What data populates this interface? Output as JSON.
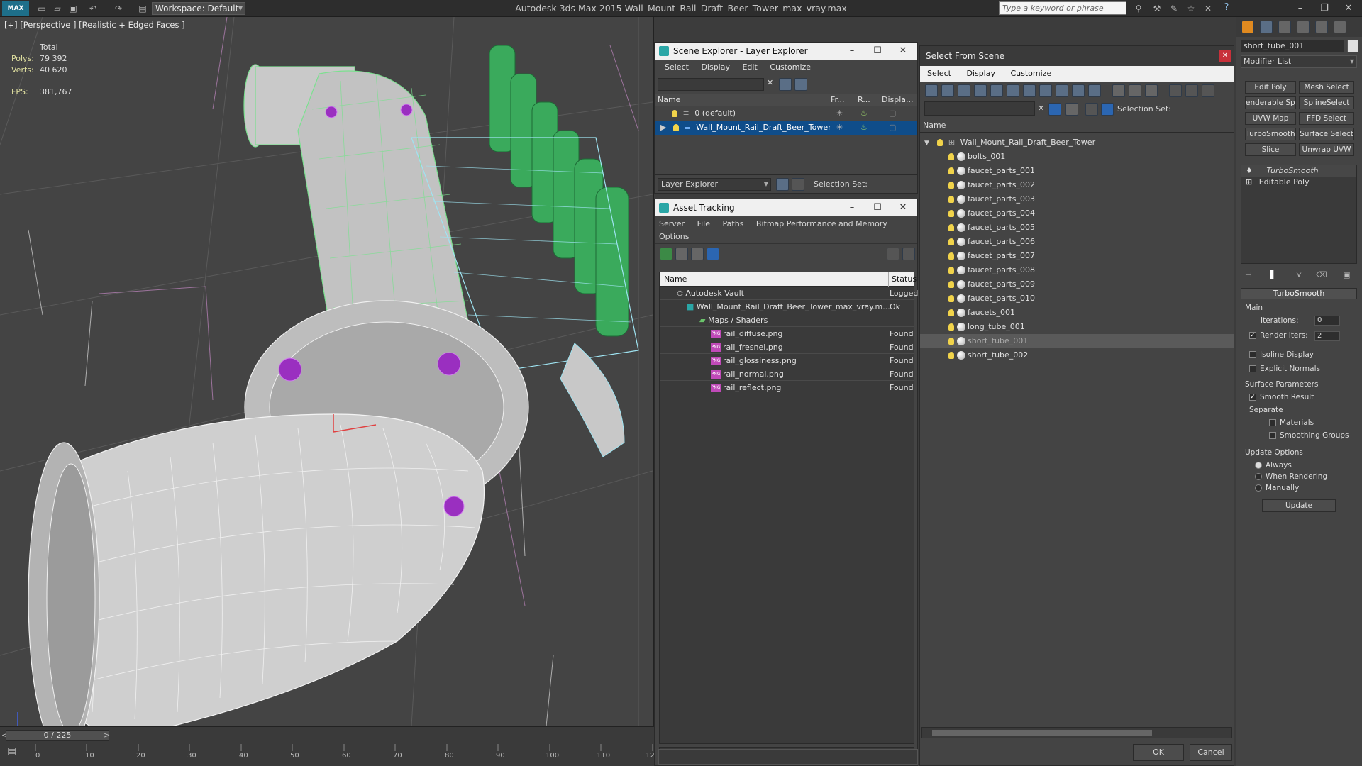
{
  "app": {
    "logo": "MAX",
    "workspace_label": "Workspace: Default",
    "title": "Autodesk 3ds Max  2015     Wall_Mount_Rail_Draft_Beer_Tower_max_vray.max",
    "search_placeholder": "Type a keyword or phrase"
  },
  "viewport": {
    "label": "[+] [Perspective ] [Realistic + Edged Faces ]",
    "stats": {
      "total_label": "Total",
      "polys_label": "Polys:",
      "polys_value": "79 392",
      "verts_label": "Verts:",
      "verts_value": "40 620",
      "fps_label": "FPS:",
      "fps_value": "381,767"
    }
  },
  "timeline": {
    "slider": "0 / 225",
    "prev": "<",
    "next": ">",
    "ticks": [
      "0",
      "10",
      "20",
      "30",
      "40",
      "50",
      "60",
      "70",
      "80",
      "90",
      "100",
      "110",
      "12"
    ]
  },
  "scene_explorer": {
    "title": "Scene Explorer - Layer Explorer",
    "menu": [
      "Select",
      "Display",
      "Edit",
      "Customize"
    ],
    "columns": {
      "name": "Name",
      "frozen": "Fr...",
      "render": "R...",
      "display": "Displa..."
    },
    "rows": [
      {
        "label": "0 (default)",
        "selected": false
      },
      {
        "label": "Wall_Mount_Rail_Draft_Beer_Tower",
        "selected": true
      }
    ],
    "footer_dropdown": "Layer Explorer",
    "footer_selection": "Selection Set:"
  },
  "asset_tracking": {
    "title": "Asset Tracking",
    "menu": [
      "Server",
      "File",
      "Paths",
      "Bitmap Performance and Memory"
    ],
    "menu2": "Options",
    "columns": {
      "name": "Name",
      "status": "Status"
    },
    "rows": [
      {
        "name": "Autodesk Vault",
        "status": "Logged",
        "indent": 0,
        "type": "vault"
      },
      {
        "name": "Wall_Mount_Rail_Draft_Beer_Tower_max_vray.m...",
        "status": "Ok",
        "indent": 1,
        "type": "max"
      },
      {
        "name": "Maps / Shaders",
        "status": "",
        "indent": 2,
        "type": "folder"
      },
      {
        "name": "rail_diffuse.png",
        "status": "Found",
        "indent": 3,
        "type": "png"
      },
      {
        "name": "rail_fresnel.png",
        "status": "Found",
        "indent": 3,
        "type": "png"
      },
      {
        "name": "rail_glossiness.png",
        "status": "Found",
        "indent": 3,
        "type": "png"
      },
      {
        "name": "rail_normal.png",
        "status": "Found",
        "indent": 3,
        "type": "png"
      },
      {
        "name": "rail_reflect.png",
        "status": "Found",
        "indent": 3,
        "type": "png"
      }
    ]
  },
  "select_from_scene": {
    "title": "Select From Scene",
    "menu": [
      "Select",
      "Display",
      "Customize"
    ],
    "selection_set": "Selection Set:",
    "column_name": "Name",
    "root": "Wall_Mount_Rail_Draft_Beer_Tower",
    "items": [
      {
        "label": "bolts_001",
        "selected": false
      },
      {
        "label": "faucet_parts_001",
        "selected": false
      },
      {
        "label": "faucet_parts_002",
        "selected": false
      },
      {
        "label": "faucet_parts_003",
        "selected": false
      },
      {
        "label": "faucet_parts_004",
        "selected": false
      },
      {
        "label": "faucet_parts_005",
        "selected": false
      },
      {
        "label": "faucet_parts_006",
        "selected": false
      },
      {
        "label": "faucet_parts_007",
        "selected": false
      },
      {
        "label": "faucet_parts_008",
        "selected": false
      },
      {
        "label": "faucet_parts_009",
        "selected": false
      },
      {
        "label": "faucet_parts_010",
        "selected": false
      },
      {
        "label": "faucets_001",
        "selected": false
      },
      {
        "label": "long_tube_001",
        "selected": false
      },
      {
        "label": "short_tube_001",
        "selected": true
      },
      {
        "label": "short_tube_002",
        "selected": false
      }
    ],
    "ok": "OK",
    "cancel": "Cancel"
  },
  "command_panel": {
    "object_name": "short_tube_001",
    "modifier_list": "Modifier List",
    "buttons": [
      "Edit Poly",
      "Mesh Select",
      "enderable Splin",
      "SplineSelect",
      "UVW Map",
      "FFD Select",
      "TurboSmooth",
      "Surface Select",
      "Slice",
      "Unwrap UVW"
    ],
    "stack": [
      "TurboSmooth",
      "Editable Poly"
    ],
    "turbosmooth": {
      "header": "TurboSmooth",
      "main": "Main",
      "iterations_label": "Iterations:",
      "iterations_value": "0",
      "render_iters_label": "Render Iters:",
      "render_iters_value": "2",
      "isoline": "Isoline Display",
      "explicit": "Explicit Normals",
      "surface_params": "Surface Parameters",
      "smooth_result": "Smooth Result",
      "separate": "Separate",
      "materials": "Materials",
      "smoothing_groups": "Smoothing Groups",
      "update_options": "Update Options",
      "always": "Always",
      "when_rendering": "When Rendering",
      "manually": "Manually",
      "update": "Update"
    }
  },
  "colors": {
    "accent": "#2aa6a6",
    "selection": "#0f4d8a",
    "wire_green": "#3fbf6a",
    "bolt_purple": "#9a2fc0"
  }
}
